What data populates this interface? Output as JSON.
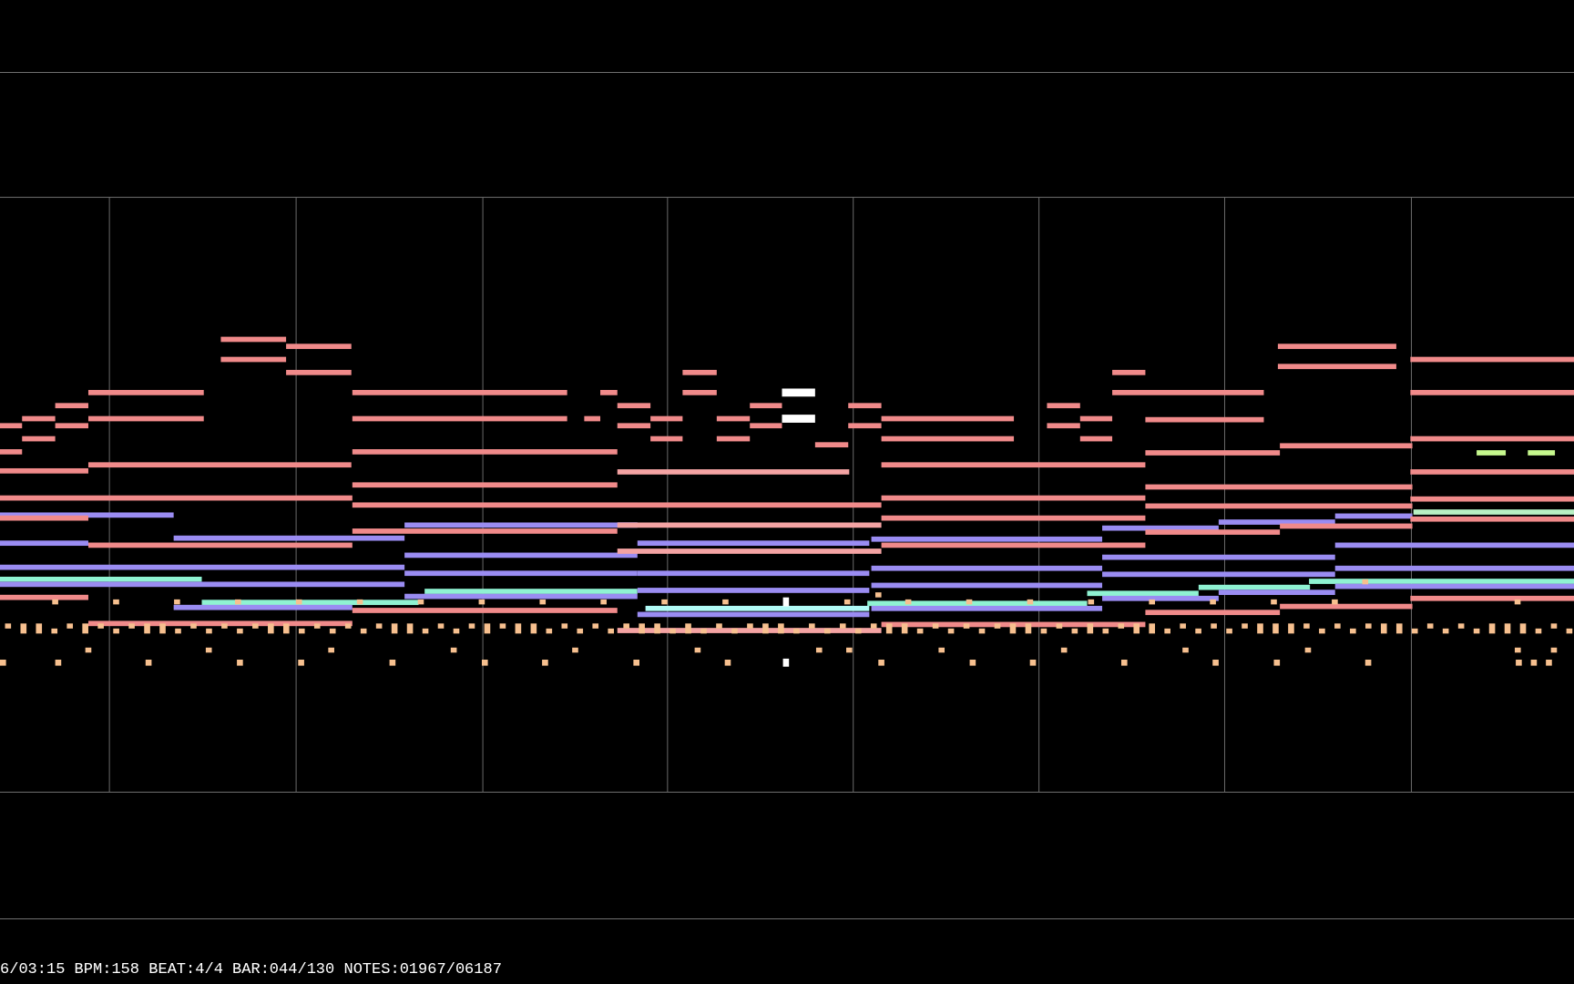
{
  "visualizer": {
    "status_line": "6/03:15 BPM:158 BEAT:4/4 BAR:044/130 NOTES:01967/06187"
  }
}
